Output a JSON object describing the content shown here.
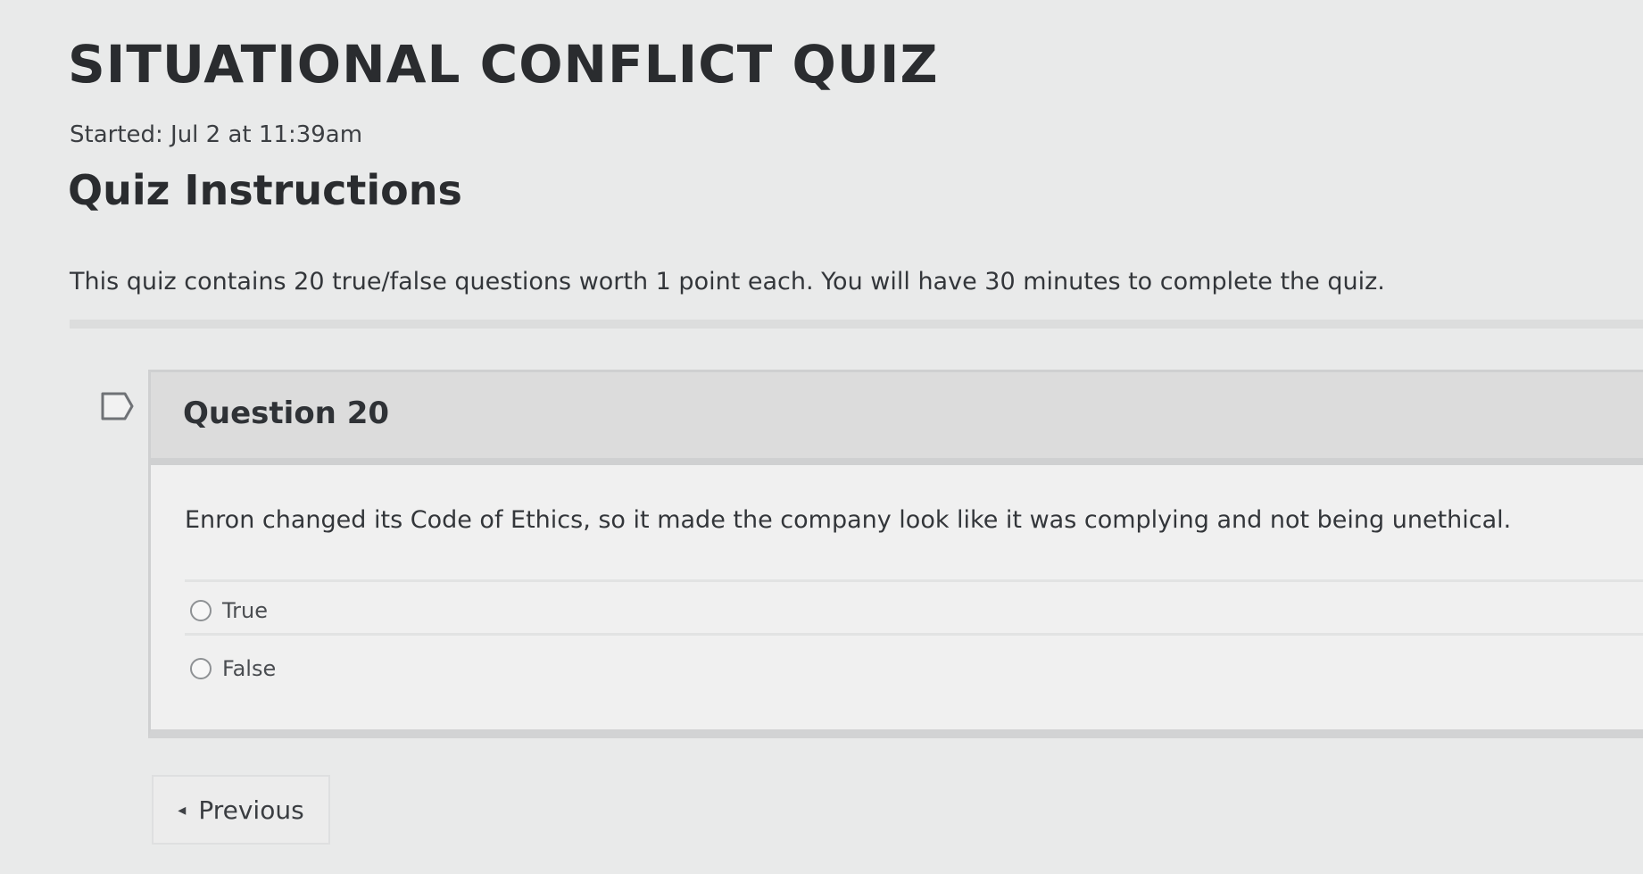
{
  "quiz": {
    "title": "SITUATIONAL CONFLICT QUIZ",
    "started": "Started: Jul 2 at 11:39am"
  },
  "instructions": {
    "heading": "Quiz Instructions",
    "text": "This quiz contains 20 true/false questions worth 1 point each. You will have 30 minutes to complete the quiz."
  },
  "question": {
    "title": "Question 20",
    "text": "Enron changed its Code of Ethics, so it made the company look like it was complying and not being unethical.",
    "answers": [
      {
        "label": "True"
      },
      {
        "label": "False"
      }
    ]
  },
  "navigation": {
    "previous_label": "Previous",
    "previous_icon": "triangle-left-icon"
  },
  "icons": {
    "flag": "flag-question-icon"
  }
}
